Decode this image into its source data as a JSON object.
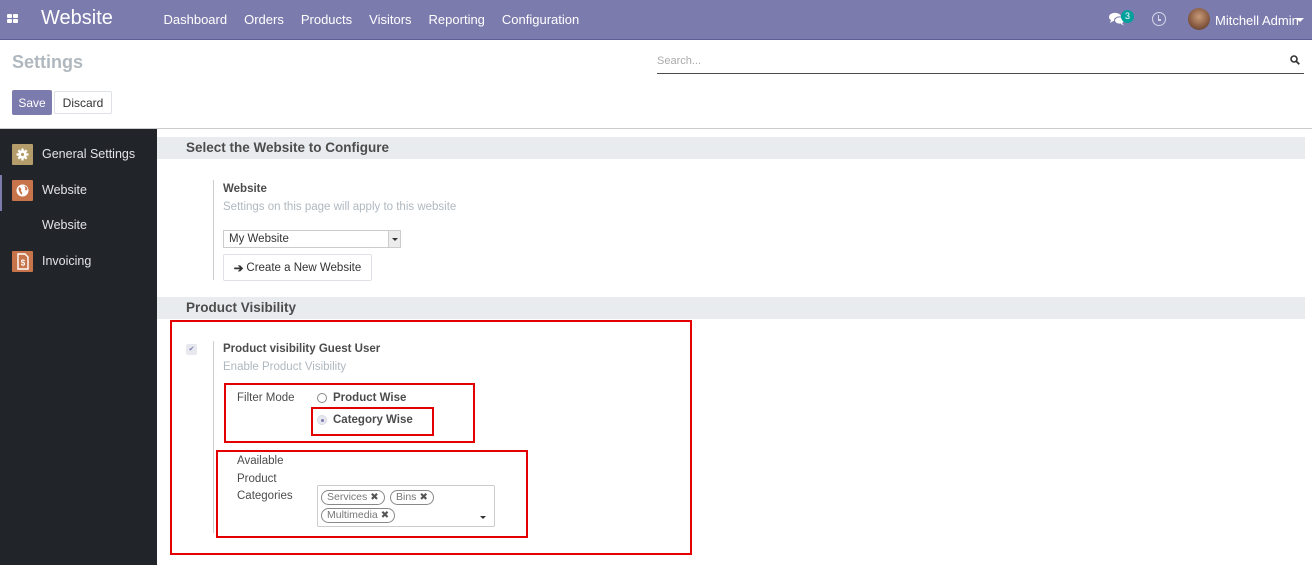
{
  "navbar": {
    "apps_icon": "apps-grid-icon",
    "brand": "Website",
    "menu": [
      "Dashboard",
      "Orders",
      "Products",
      "Visitors",
      "Reporting",
      "Configuration"
    ],
    "messages_icon": "chat-icon",
    "messages_count": "3",
    "activity_icon": "clock-icon",
    "user_name": "Mitchell Admin",
    "accent_color": "#7c7bad"
  },
  "control_panel": {
    "title": "Settings",
    "search_placeholder": "Search...",
    "save_label": "Save",
    "discard_label": "Discard"
  },
  "sidebar": {
    "items": [
      {
        "label": "General Settings",
        "icon": "gear-icon"
      },
      {
        "label": "Website",
        "icon": "globe-icon",
        "active": true
      },
      {
        "label": "Website",
        "sub": true
      },
      {
        "label": "Invoicing",
        "icon": "invoice-icon"
      }
    ]
  },
  "sections": {
    "select_website": {
      "heading": "Select the Website to Configure",
      "setting_title": "Website",
      "setting_help": "Settings on this page will apply to this website",
      "selected_website": "My Website",
      "create_button": "Create a New Website"
    },
    "product_visibility": {
      "heading": "Product Visibility",
      "enabled": true,
      "setting_title": "Product visibility Guest User",
      "setting_help": "Enable Product Visibility",
      "filter_mode_label": "Filter Mode",
      "filter_modes": [
        {
          "label": "Product Wise",
          "checked": false
        },
        {
          "label": "Category Wise",
          "checked": true
        }
      ],
      "categories_label_lines": [
        "Available",
        "Product",
        "Categories"
      ],
      "categories": [
        "Services",
        "Bins",
        "Multimedia"
      ],
      "tag_remove_glyph": "✖"
    }
  },
  "annotation_color": "#e30000"
}
